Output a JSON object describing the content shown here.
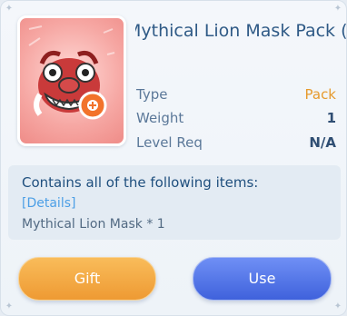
{
  "item": {
    "title": "Mythical Lion Mask Pack (Gi",
    "image_icon": "lion-mask-pack-icon"
  },
  "stats": {
    "type_label": "Type",
    "type_value": "Pack",
    "weight_label": "Weight",
    "weight_value": "1",
    "level_label": "Level Req",
    "level_value": "N/A"
  },
  "contents": {
    "heading": "Contains all of the following items:",
    "details_link": "[Details]",
    "items": [
      "Mythical Lion Mask * 1"
    ]
  },
  "actions": {
    "gift_label": "Gift",
    "use_label": "Use"
  },
  "colors": {
    "title": "#2f5a86",
    "pack_value": "#e69a2c",
    "gift_button": "#ee9a33",
    "use_button": "#3f62dc",
    "details_link": "#4c9fe6"
  }
}
